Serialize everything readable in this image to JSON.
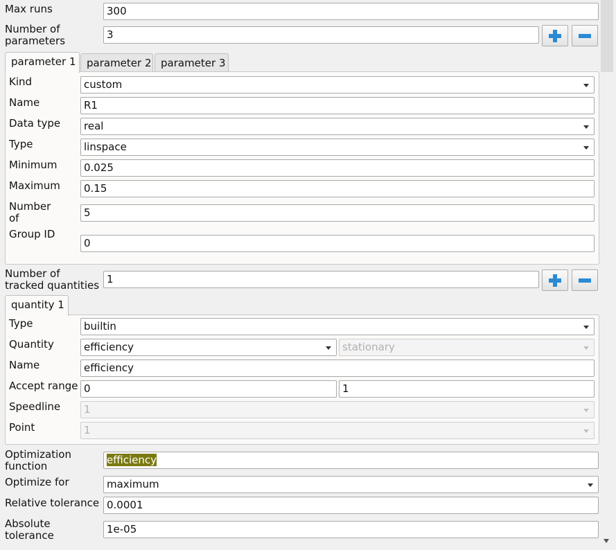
{
  "max_runs": {
    "label": "Max runs",
    "value": "300"
  },
  "num_params": {
    "label": "Number of parameters",
    "value": "3"
  },
  "param_tabs": [
    "parameter 1",
    "parameter 2",
    "parameter 3"
  ],
  "param": {
    "kind": {
      "label": "Kind",
      "value": "custom"
    },
    "name": {
      "label": "Name",
      "value": "R1"
    },
    "data_type": {
      "label": "Data type",
      "value": "real"
    },
    "type": {
      "label": "Type",
      "value": "linspace"
    },
    "minimum": {
      "label": "Minimum",
      "value": "0.025"
    },
    "maximum": {
      "label": "Maximum",
      "value": "0.15"
    },
    "number_of": {
      "label": "Number of",
      "value": "5"
    },
    "group_id": {
      "label": "Group ID",
      "value": "0"
    }
  },
  "num_tracked": {
    "label": "Number of tracked quantities",
    "value": "1"
  },
  "quantity_tabs": [
    "quantity 1"
  ],
  "quantity": {
    "type": {
      "label": "Type",
      "value": "builtin"
    },
    "quantity": {
      "label": "Quantity",
      "value": "efficiency",
      "mode": "stationary"
    },
    "name": {
      "label": "Name",
      "value": "efficiency"
    },
    "accept_range": {
      "label": "Accept range",
      "min": "0",
      "max": "1"
    },
    "speedline": {
      "label": "Speedline",
      "value": "1"
    },
    "point": {
      "label": "Point",
      "value": "1"
    }
  },
  "optimization_function": {
    "label": "Optimization function",
    "value": "efficiency"
  },
  "optimize_for": {
    "label": "Optimize for",
    "value": "maximum"
  },
  "relative_tolerance": {
    "label": "Relative tolerance",
    "value": "0.0001"
  },
  "absolute_tolerance": {
    "label": "Absolute tolerance",
    "value": "1e-05"
  },
  "colors": {
    "plus": "#2a8ad4",
    "minus": "#2a8ad4",
    "highlight": "#7a7a10"
  },
  "icons": {
    "add": "plus-icon",
    "remove": "minus-icon",
    "dropdown": "chevron-down-icon"
  }
}
